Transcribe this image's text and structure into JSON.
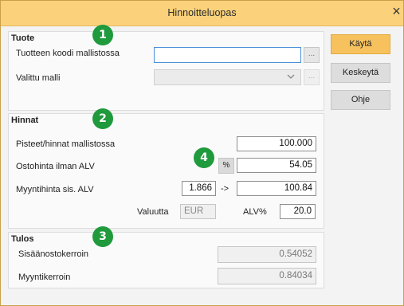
{
  "window": {
    "title": "Hinnoitteluopas",
    "close_glyph": "×"
  },
  "tuote": {
    "title": "Tuote",
    "product_code_label": "Tuotteen koodi mallistossa",
    "product_code_value": "",
    "browse_glyph": "...",
    "selected_model_label": "Valittu malli",
    "selected_model_value": "",
    "model_browse_glyph": "..."
  },
  "hinnat": {
    "title": "Hinnat",
    "points_label": "Pisteet/hinnat mallistossa",
    "points_value": "100.000",
    "purchase_label": "Ostohinta ilman ALV",
    "percent_button": "%",
    "purchase_value": "54.05",
    "sale_label": "Myyntihinta sis. ALV",
    "factor_value": "1.866",
    "arrow": "->",
    "sale_value": "100.84",
    "currency_label": "Valuutta",
    "currency_value": "EUR",
    "vat_label": "ALV%",
    "vat_value": "20.0"
  },
  "tulos": {
    "title": "Tulos",
    "purchase_factor_label": "Sisäänostokerroin",
    "purchase_factor_value": "0.54052",
    "sales_factor_label": "Myyntikerroin",
    "sales_factor_value": "0.84034"
  },
  "buttons": {
    "apply": "Käytä",
    "cancel": "Keskeytä",
    "help": "Ohje"
  },
  "badges": {
    "b1": "1",
    "b2": "2",
    "b3": "3",
    "b4": "4"
  },
  "colors": {
    "titlebar": "#fbd27b",
    "primary_button": "#f7c25e",
    "badge": "#1f9a3c",
    "active_border": "#4a90d9"
  }
}
